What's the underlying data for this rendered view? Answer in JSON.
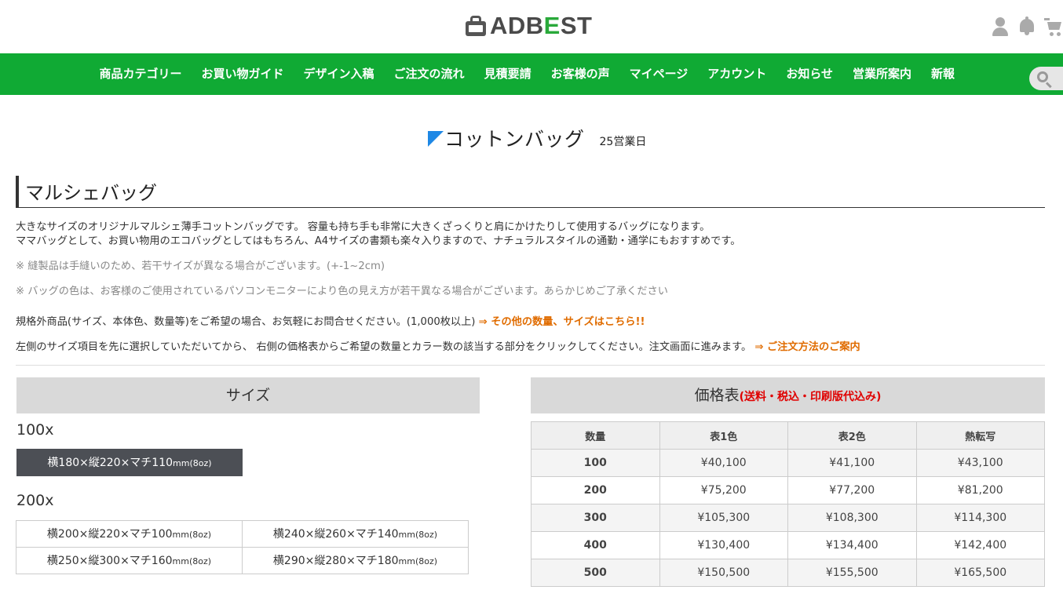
{
  "header": {
    "logo_text_a": "ADB",
    "logo_text_e": "E",
    "logo_text_b": "ST",
    "icons": [
      "user-icon",
      "bell-icon",
      "cart-icon"
    ]
  },
  "nav": {
    "items": [
      "商品カテゴリー",
      "お買い物ガイド",
      "デザイン入稿",
      "ご注文の流れ",
      "見積要請",
      "お客様の声",
      "マイページ",
      "アカウント",
      "お知らせ",
      "営業所案内",
      "新報"
    ]
  },
  "product": {
    "name": "コットンバッグ",
    "lead_time": "25営業日",
    "section_title": "マルシェバッグ"
  },
  "description": {
    "line1": "大きなサイズのオリジナルマルシェ薄手コットンバッグです。 容量も持ち手も非常に大きくざっくりと肩にかけたりして使用するバッグになります。",
    "line2": "ママバッグとして、お買い物用のエコバッグとしてはもちろん、A4サイズの書類も楽々入りますので、ナチュラルスタイルの通勤・通学にもおすすめです。",
    "note1": "※ 縫製品は手縫いのため、若干サイズが異なる場合がございます。(+-1~2cm)",
    "note2": "※ バッグの色は、お客様のご使用されているパソコンモニターにより色の見え方が若干異なる場合がございます。あらかじめご了承ください",
    "custom_text": "規格外商品(サイズ、本体色、数量等)をご希望の場合、お気軽にお問合せください。(1,000枚以上) ",
    "custom_link": "⇒ その他の数量、サイズはこちら!!",
    "order_text": "左側のサイズ項目を先に選択していただいてから、 右側の価格表からご希望の数量とカラー数の該当する部分をクリックしてください。注文画面に進みます。 ",
    "order_link": "⇒ ご注文方法のご案内"
  },
  "size_panel": {
    "title": "サイズ",
    "groups": [
      {
        "label": "100x",
        "sizes": [
          {
            "main": "横180×縦220×マチ110",
            "unit": "mm(8oz)",
            "selected": true
          }
        ]
      },
      {
        "label": "200x",
        "sizes": [
          {
            "main": "横200×縦220×マチ100",
            "unit": "mm(8oz)",
            "selected": false
          },
          {
            "main": "横240×縦260×マチ140",
            "unit": "mm(8oz)",
            "selected": false
          },
          {
            "main": "横250×縦300×マチ160",
            "unit": "mm(8oz)",
            "selected": false
          },
          {
            "main": "横290×縦280×マチ180",
            "unit": "mm(8oz)",
            "selected": false
          }
        ]
      }
    ]
  },
  "price_panel": {
    "title": "価格表",
    "title_note": "(送料・税込・印刷版代込み)",
    "columns": [
      "数量",
      "表1色",
      "表2色",
      "熱転写"
    ],
    "rows": [
      {
        "qty": "100",
        "p1": "¥40,100",
        "p2": "¥41,100",
        "p3": "¥43,100"
      },
      {
        "qty": "200",
        "p1": "¥75,200",
        "p2": "¥77,200",
        "p3": "¥81,200"
      },
      {
        "qty": "300",
        "p1": "¥105,300",
        "p2": "¥108,300",
        "p3": "¥114,300"
      },
      {
        "qty": "400",
        "p1": "¥130,400",
        "p2": "¥134,400",
        "p3": "¥142,400"
      },
      {
        "qty": "500",
        "p1": "¥150,500",
        "p2": "¥155,500",
        "p3": "¥165,500"
      }
    ]
  },
  "colors": {
    "nav_green": "#10aa34",
    "accent_orange": "#e06c00",
    "accent_red": "#e00000",
    "title_blue": "#1e88e5"
  }
}
